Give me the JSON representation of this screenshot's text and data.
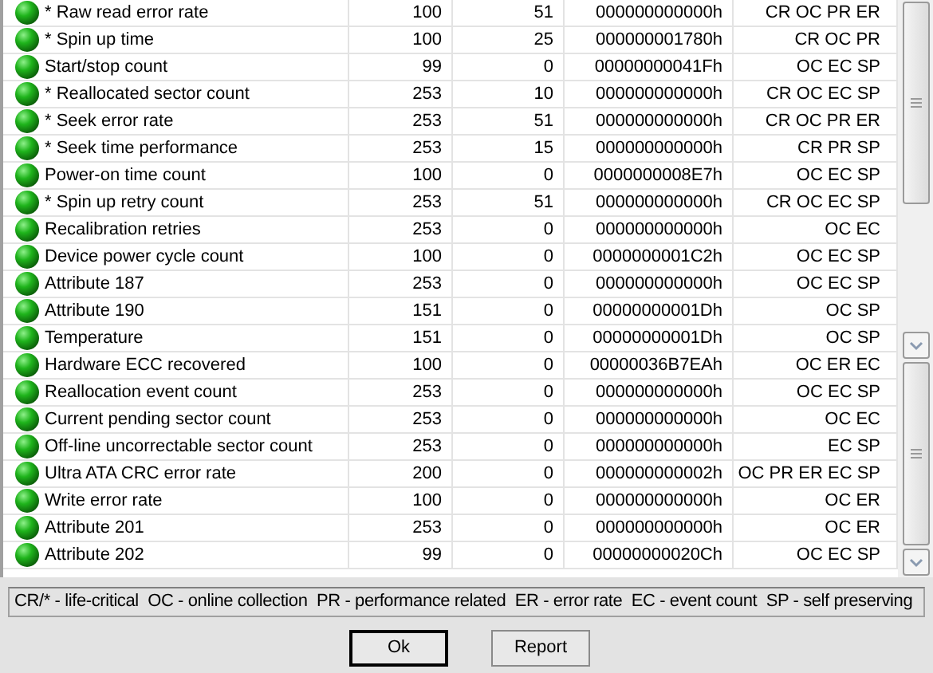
{
  "table": {
    "rows": [
      {
        "name": "* Raw read error rate",
        "value": "100",
        "worst": "51",
        "raw": "000000000000h",
        "flags": "CR OC PR ER"
      },
      {
        "name": "* Spin up time",
        "value": "100",
        "worst": "25",
        "raw": "000000001780h",
        "flags": "CR OC PR"
      },
      {
        "name": "Start/stop count",
        "value": "99",
        "worst": "0",
        "raw": "00000000041Fh",
        "flags": "OC EC SP"
      },
      {
        "name": "* Reallocated sector count",
        "value": "253",
        "worst": "10",
        "raw": "000000000000h",
        "flags": "CR OC EC SP"
      },
      {
        "name": "* Seek error rate",
        "value": "253",
        "worst": "51",
        "raw": "000000000000h",
        "flags": "CR OC PR ER"
      },
      {
        "name": "* Seek time performance",
        "value": "253",
        "worst": "15",
        "raw": "000000000000h",
        "flags": "CR PR SP"
      },
      {
        "name": "Power-on time count",
        "value": "100",
        "worst": "0",
        "raw": "0000000008E7h",
        "flags": "OC EC SP"
      },
      {
        "name": "* Spin up retry count",
        "value": "253",
        "worst": "51",
        "raw": "000000000000h",
        "flags": "CR OC EC SP"
      },
      {
        "name": "Recalibration retries",
        "value": "253",
        "worst": "0",
        "raw": "000000000000h",
        "flags": "OC EC"
      },
      {
        "name": "Device power cycle count",
        "value": "100",
        "worst": "0",
        "raw": "0000000001C2h",
        "flags": "OC EC SP"
      },
      {
        "name": "Attribute 187",
        "value": "253",
        "worst": "0",
        "raw": "000000000000h",
        "flags": "OC EC SP"
      },
      {
        "name": "Attribute 190",
        "value": "151",
        "worst": "0",
        "raw": "00000000001Dh",
        "flags": "OC SP"
      },
      {
        "name": "Temperature",
        "value": "151",
        "worst": "0",
        "raw": "00000000001Dh",
        "flags": "OC SP"
      },
      {
        "name": "Hardware ECC recovered",
        "value": "100",
        "worst": "0",
        "raw": "00000036B7EAh",
        "flags": "OC ER EC"
      },
      {
        "name": "Reallocation event count",
        "value": "253",
        "worst": "0",
        "raw": "000000000000h",
        "flags": "OC EC SP"
      },
      {
        "name": "Current pending sector count",
        "value": "253",
        "worst": "0",
        "raw": "000000000000h",
        "flags": "OC EC"
      },
      {
        "name": "Off-line uncorrectable sector count",
        "value": "253",
        "worst": "0",
        "raw": "000000000000h",
        "flags": "EC SP"
      },
      {
        "name": "Ultra ATA CRC error rate",
        "value": "200",
        "worst": "0",
        "raw": "000000000002h",
        "flags": "OC PR ER EC SP"
      },
      {
        "name": "Write error rate",
        "value": "100",
        "worst": "0",
        "raw": "000000000000h",
        "flags": "OC ER"
      },
      {
        "name": "Attribute 201",
        "value": "253",
        "worst": "0",
        "raw": "000000000000h",
        "flags": "OC ER"
      },
      {
        "name": "Attribute 202",
        "value": "99",
        "worst": "0",
        "raw": "00000000020Ch",
        "flags": "OC EC SP"
      }
    ]
  },
  "legend": "CR/* - life-critical  OC - online collection  PR - performance related  ER - error rate  EC - event count  SP - self preserving",
  "buttons": [
    {
      "label": "Ok",
      "kind": "default"
    },
    {
      "label": "Report",
      "kind": "normal"
    }
  ]
}
